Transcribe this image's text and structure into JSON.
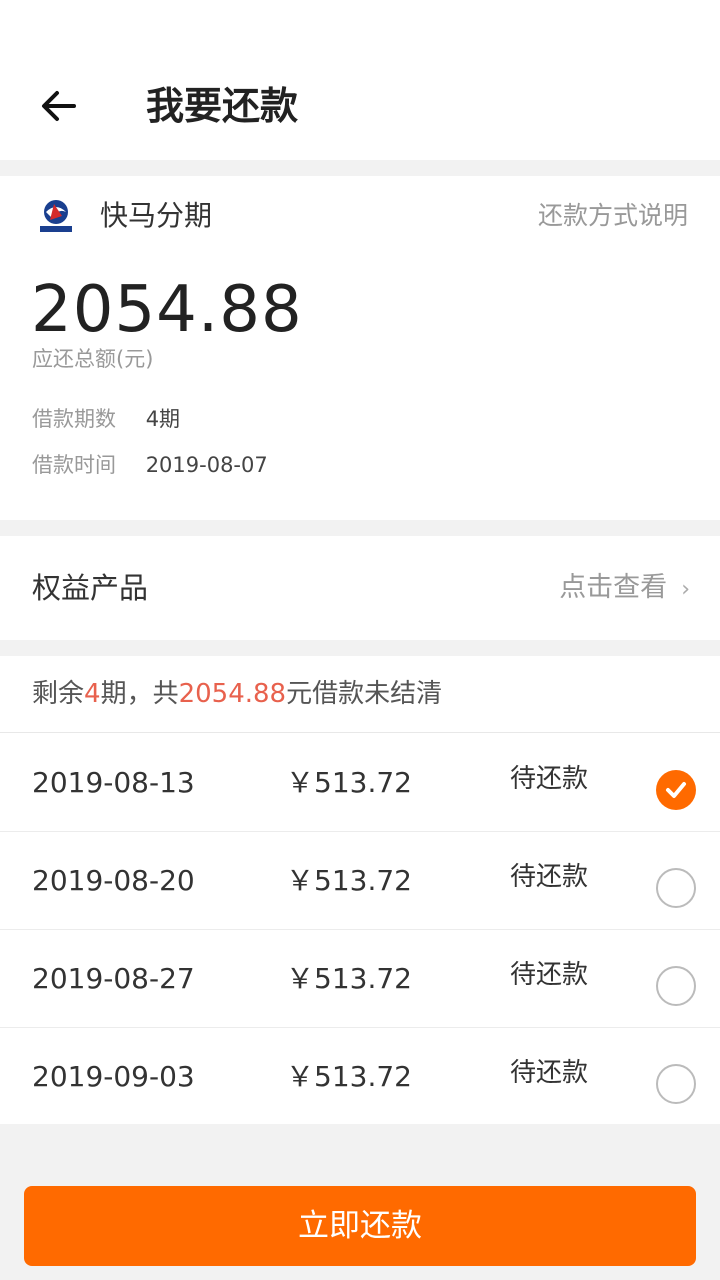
{
  "header": {
    "title": "我要还款",
    "back_icon": "arrow-left-icon"
  },
  "loan": {
    "provider_name": "快马分期",
    "repay_method_link": "还款方式说明",
    "total_amount": "2054.88",
    "total_label": "应还总额(元)",
    "periods_label": "借款期数",
    "periods_value": "4期",
    "time_label": "借款时间",
    "time_value": "2019-08-07"
  },
  "benefit": {
    "title": "权益产品",
    "link": "点击查看",
    "chevron": "›"
  },
  "plan": {
    "summary_prefix": "剩余",
    "summary_periods": "4",
    "summary_mid": "期，共",
    "summary_amount": "2054.88",
    "summary_suffix": "元借款未结清",
    "installments": [
      {
        "date": "2019-08-13",
        "amount": "￥513.72",
        "status": "待还款",
        "selected": true
      },
      {
        "date": "2019-08-20",
        "amount": "￥513.72",
        "status": "待还款",
        "selected": false
      },
      {
        "date": "2019-08-27",
        "amount": "￥513.72",
        "status": "待还款",
        "selected": false
      },
      {
        "date": "2019-09-03",
        "amount": "￥513.72",
        "status": "待还款",
        "selected": false
      }
    ]
  },
  "pay_button": {
    "label": "立即还款"
  },
  "colors": {
    "accent": "#ff6a00",
    "highlight": "#e8614d",
    "background": "#f2f2f2"
  }
}
